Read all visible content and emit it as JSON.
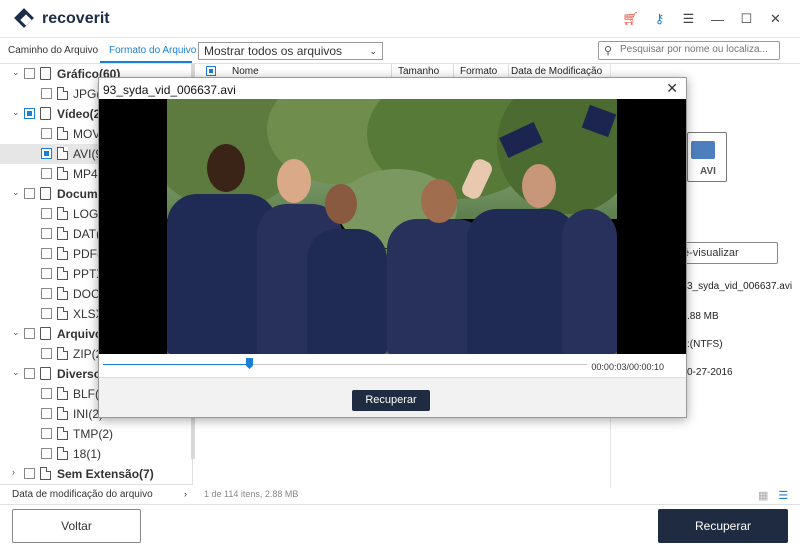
{
  "app": {
    "name": "recoverit"
  },
  "titlebar": {
    "icons": [
      "cart-icon",
      "key-icon",
      "menu-icon",
      "minimize-icon",
      "maximize-icon",
      "close-icon"
    ]
  },
  "tabs": [
    {
      "label": "Caminho do Arquivo"
    },
    {
      "label": "Formato do Arquivo"
    }
  ],
  "filter": {
    "value": "Mostrar todos os arquivos"
  },
  "search": {
    "placeholder": "Pesquisar por nome ou localiza..."
  },
  "tree": [
    {
      "label": "Gráfico(60)",
      "bold": true
    },
    {
      "label": "JPG(6"
    },
    {
      "label": "Vídeo(24",
      "bold": true
    },
    {
      "label": "MOV"
    },
    {
      "label": "AVI(9"
    },
    {
      "label": "MP4("
    },
    {
      "label": "Docume",
      "bold": true
    },
    {
      "label": "LOG("
    },
    {
      "label": "DAT(2"
    },
    {
      "label": "PDF(3"
    },
    {
      "label": "PPTX"
    },
    {
      "label": "DOC("
    },
    {
      "label": "XLSX"
    },
    {
      "label": "Arquivo(",
      "bold": true
    },
    {
      "label": "ZIP(2"
    },
    {
      "label": "Diverso(",
      "bold": true
    },
    {
      "label": "BLF(2"
    },
    {
      "label": "INI(2)"
    },
    {
      "label": "TMP(2)"
    },
    {
      "label": "18(1)"
    },
    {
      "label": "Sem Extensão(7)",
      "bold": true
    }
  ],
  "date_filter": {
    "label": "Data de modificação do arquivo"
  },
  "table": {
    "headers": {
      "name": "Nome",
      "size": "Tamanho",
      "format": "Formato",
      "date": "Data de Modificação"
    },
    "footer": "1 de 114 itens, 2.88  MB"
  },
  "right_panel": {
    "file_badge": "AVI",
    "preview_button": "é-visualizar",
    "filename": "3_syda_vid_006637.avi",
    "size": ".88  MB",
    "path": ":(NTFS)",
    "date": "0-27-2016"
  },
  "bottom": {
    "back": "Voltar",
    "recover": "Recuperar"
  },
  "dialog": {
    "title": "93_syda_vid_006637.avi",
    "time": "00:00:03/00:00:10",
    "progress": 0.3,
    "recover": "Recuperar"
  }
}
